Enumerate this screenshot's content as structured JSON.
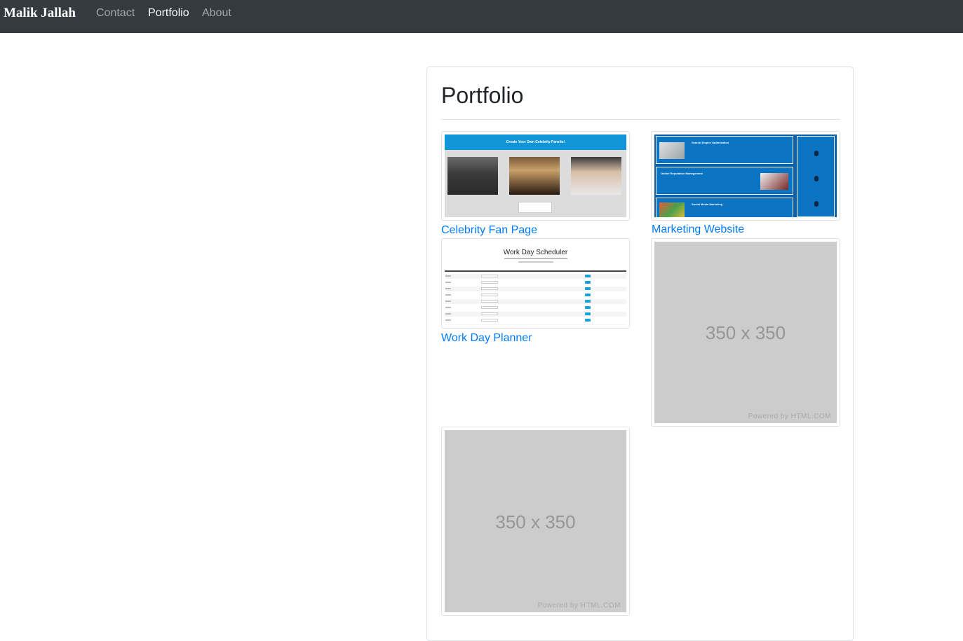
{
  "navbar": {
    "brand": "Malik Jallah",
    "links": [
      "Contact",
      "Portfolio",
      "About"
    ],
    "active": "Portfolio"
  },
  "portfolio": {
    "title": "Portfolio",
    "projects": [
      {
        "label": "Celebrity Fan Page",
        "thumb_title": "Create Your Own Celebrity Fansite!"
      },
      {
        "label": "Marketing Website",
        "sections": [
          "Search Engine Optimization",
          "Online Reputation Management",
          "Social Media Marketing"
        ]
      },
      {
        "label": "Work Day Planner",
        "thumb_title": "Work Day Scheduler"
      }
    ],
    "placeholders": [
      {
        "text": "350 x 350",
        "footer": "Powered by HTML.COM"
      },
      {
        "text": "350 x 350",
        "footer": "Powered by HTML.COM"
      }
    ]
  },
  "colors": {
    "navbar_bg": "#343a40",
    "link": "#007bff",
    "placeholder_bg": "#cccccc"
  }
}
